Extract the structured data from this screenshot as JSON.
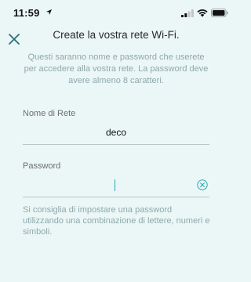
{
  "status_bar": {
    "time": "11:59"
  },
  "header": {
    "close_icon": "close-icon",
    "title": "Create la vostra rete Wi-Fi.",
    "subtitle": "Questi saranno nome e password che userete per accedere alla vostra rete. La password deve avere almeno 8 caratteri."
  },
  "network_field": {
    "label": "Nome di Rete",
    "value": "deco"
  },
  "password_field": {
    "label": "Password",
    "value": "",
    "clear_icon": "clear-icon"
  },
  "hint": "Si consiglia di impostare una password utilizzando una combinazione di lettere, numeri e simboli.",
  "colors": {
    "background": "#ebf7f6",
    "accent": "#2aa7b0",
    "muted_text": "#8fa8ad"
  }
}
